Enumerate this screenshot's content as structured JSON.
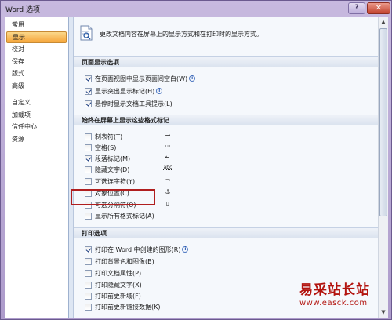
{
  "window": {
    "title": "Word 选项",
    "help_label": "?",
    "close_label": "✕"
  },
  "sidebar": {
    "items": [
      {
        "label": "常用",
        "active": false
      },
      {
        "label": "显示",
        "active": true
      },
      {
        "label": "校对",
        "active": false
      },
      {
        "label": "保存",
        "active": false
      },
      {
        "label": "版式",
        "active": false
      },
      {
        "label": "高级",
        "active": false
      },
      {
        "label": "自定义",
        "active": false
      },
      {
        "label": "加载项",
        "active": false
      },
      {
        "label": "信任中心",
        "active": false
      },
      {
        "label": "资源",
        "active": false
      }
    ]
  },
  "description": "更改文档内容在屏幕上的显示方式和在打印时的显示方式。",
  "sections": {
    "page_display": {
      "title": "页面显示选项",
      "options": [
        {
          "label": "在页面视图中显示页面间空白(W)",
          "checked": true,
          "info": true
        },
        {
          "label": "显示突出显示标记(H)",
          "checked": true,
          "info": true
        },
        {
          "label": "悬停时显示文档工具提示(L)",
          "checked": true,
          "info": false
        }
      ]
    },
    "formatting_marks": {
      "title": "始终在屏幕上显示这些格式标记",
      "options": [
        {
          "label": "制表符(T)",
          "checked": false,
          "symbol": "→"
        },
        {
          "label": "空格(S)",
          "checked": false,
          "symbol": "···"
        },
        {
          "label": "段落标记(M)",
          "checked": true,
          "symbol": "↵"
        },
        {
          "label": "隐藏文字(D)",
          "checked": false,
          "symbol": "abc"
        },
        {
          "label": "可选连字符(Y)",
          "checked": false,
          "symbol": "¬"
        },
        {
          "label": "对象位置(C)",
          "checked": false,
          "symbol": "⚓"
        },
        {
          "label": "可选分隔符(O)",
          "checked": false,
          "symbol": "▯"
        },
        {
          "label": "显示所有格式标记(A)",
          "checked": false,
          "symbol": ""
        }
      ]
    },
    "printing": {
      "title": "打印选项",
      "options": [
        {
          "label": "打印在 Word 中创建的图形(R)",
          "checked": true,
          "info": true
        },
        {
          "label": "打印背景色和图像(B)",
          "checked": false,
          "info": false
        },
        {
          "label": "打印文档属性(P)",
          "checked": false,
          "info": false
        },
        {
          "label": "打印隐藏文字(X)",
          "checked": false,
          "info": false
        },
        {
          "label": "打印前更新域(F)",
          "checked": false,
          "info": false
        },
        {
          "label": "打印前更新链接数据(K)",
          "checked": false,
          "info": false
        }
      ]
    }
  },
  "watermark": {
    "line1": "易采站长站",
    "line2": "www.easck.com"
  }
}
